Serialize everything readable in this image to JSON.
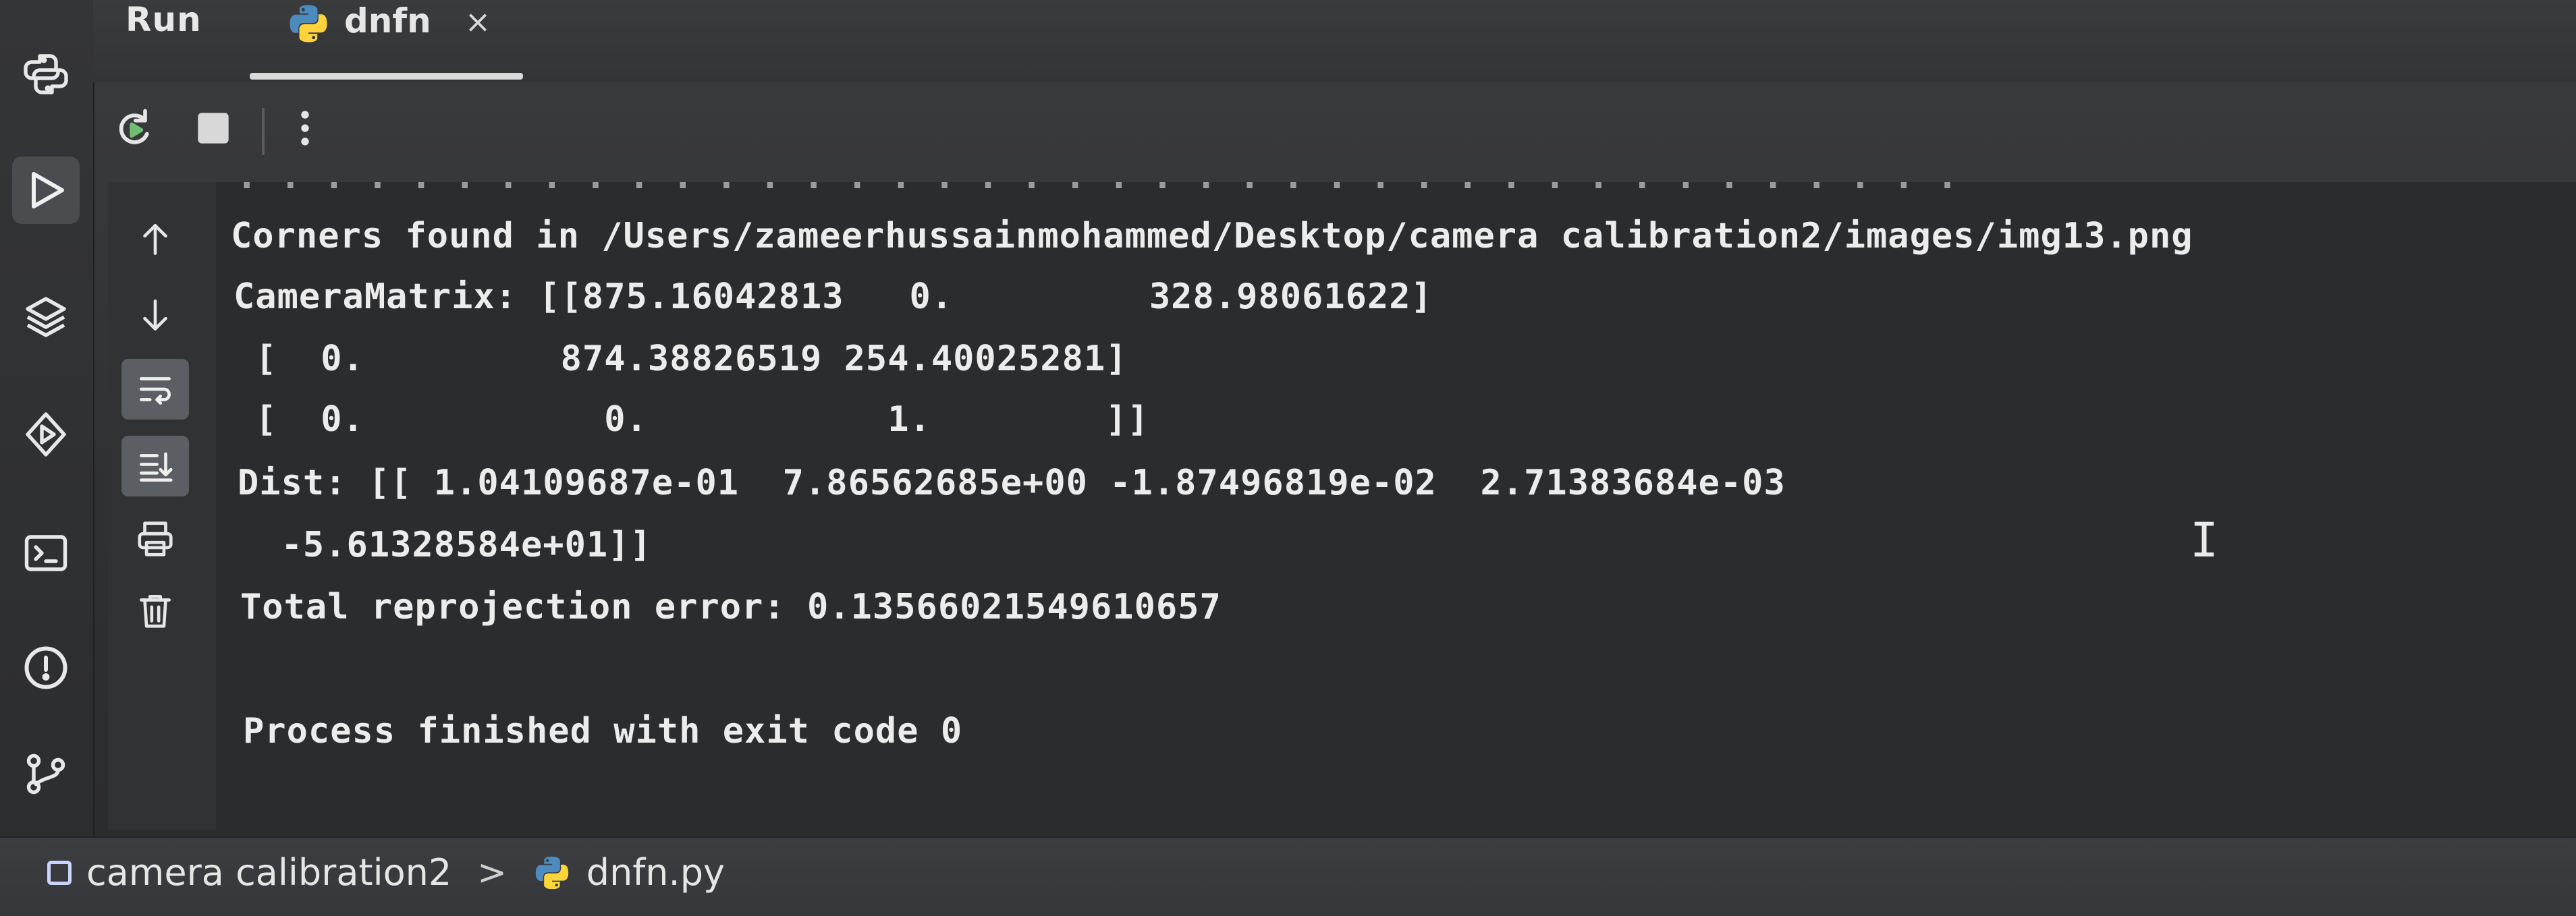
{
  "header": {
    "panel_title": "Run",
    "tab": {
      "label": "dnfn",
      "close_glyph": "×",
      "icon": "python-icon"
    }
  },
  "toolbar": {
    "icons": [
      "rerun-icon",
      "stop-icon",
      "more-options-icon"
    ]
  },
  "activity_bar": {
    "icons": [
      "python-packages-icon",
      "run-icon",
      "layers-icon",
      "services-icon",
      "terminal-icon",
      "problems-icon",
      "git-icon"
    ],
    "active": "run-icon"
  },
  "console_gutter": {
    "icons": [
      "up-arrow-icon",
      "down-arrow-icon",
      "soft-wrap-icon",
      "scroll-to-end-icon",
      "print-icon",
      "trash-icon"
    ]
  },
  "console": {
    "cut_line": ". . . . . . . . . . . . . . . . . . . . . . . . . . . . . . . . . . . . . . . .",
    "lines": [
      "Corners found in /Users/zameerhussainmohammed/Desktop/camera calibration2/images/img13.png",
      "CameraMatrix: [[875.16042813   0.         328.98061622]",
      " [  0.         874.38826519 254.40025281]",
      " [  0.           0.           1.        ]]",
      "Dist: [[ 1.04109687e-01  7.86562685e+00 -1.87496819e-02  2.71383684e-03",
      "  -5.61328584e+01]]",
      "Total reprojection error: 0.13566021549610657",
      "",
      "Process finished with exit code 0"
    ]
  },
  "statusbar": {
    "project": "camera calibration2",
    "separator": ">",
    "file": "dnfn.py"
  },
  "colors": {
    "console_bg": "#2b2c2e",
    "text": "#ececec",
    "active_icon_bg": "#4a4c50"
  }
}
